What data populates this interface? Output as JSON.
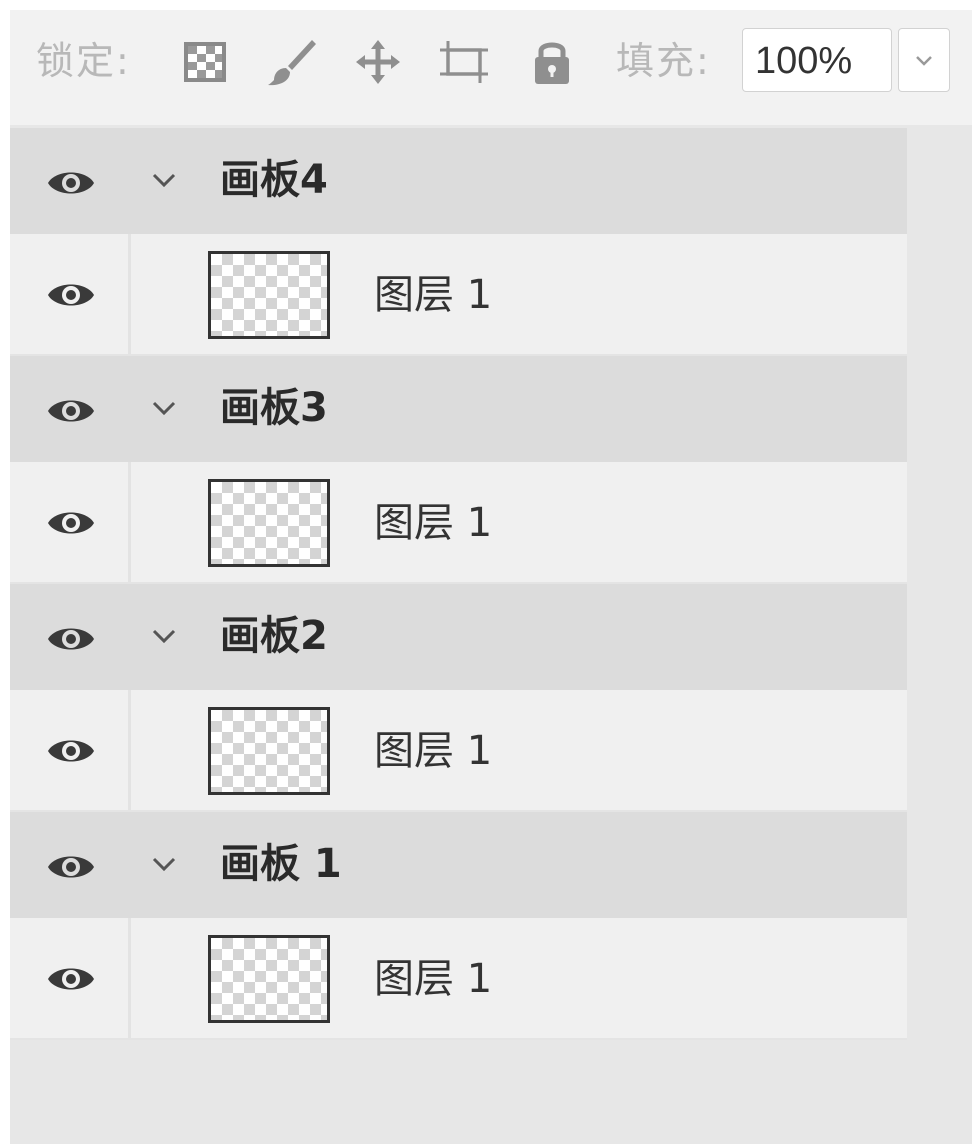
{
  "toolbar": {
    "lock_label": "锁定:",
    "fill_label": "填充:",
    "fill_value": "100%",
    "icons": [
      "lock-transparent-pixels-icon",
      "lock-image-pixels-icon",
      "lock-position-icon",
      "lock-artboard-icon",
      "lock-all-icon"
    ]
  },
  "colors": {
    "panel_bg": "#e7e7e7",
    "board_row": "#dcdcdc",
    "layer_row": "#f0f0f0",
    "icon": "#3a3a3a",
    "disabled_text": "#b8b8b8"
  },
  "artboards": [
    {
      "name": "画板4",
      "layers": [
        {
          "name": "图层 1"
        }
      ]
    },
    {
      "name": "画板3",
      "layers": [
        {
          "name": "图层 1"
        }
      ]
    },
    {
      "name": "画板2",
      "layers": [
        {
          "name": "图层 1"
        }
      ]
    },
    {
      "name": "画板 1",
      "layers": [
        {
          "name": "图层 1"
        }
      ]
    }
  ]
}
